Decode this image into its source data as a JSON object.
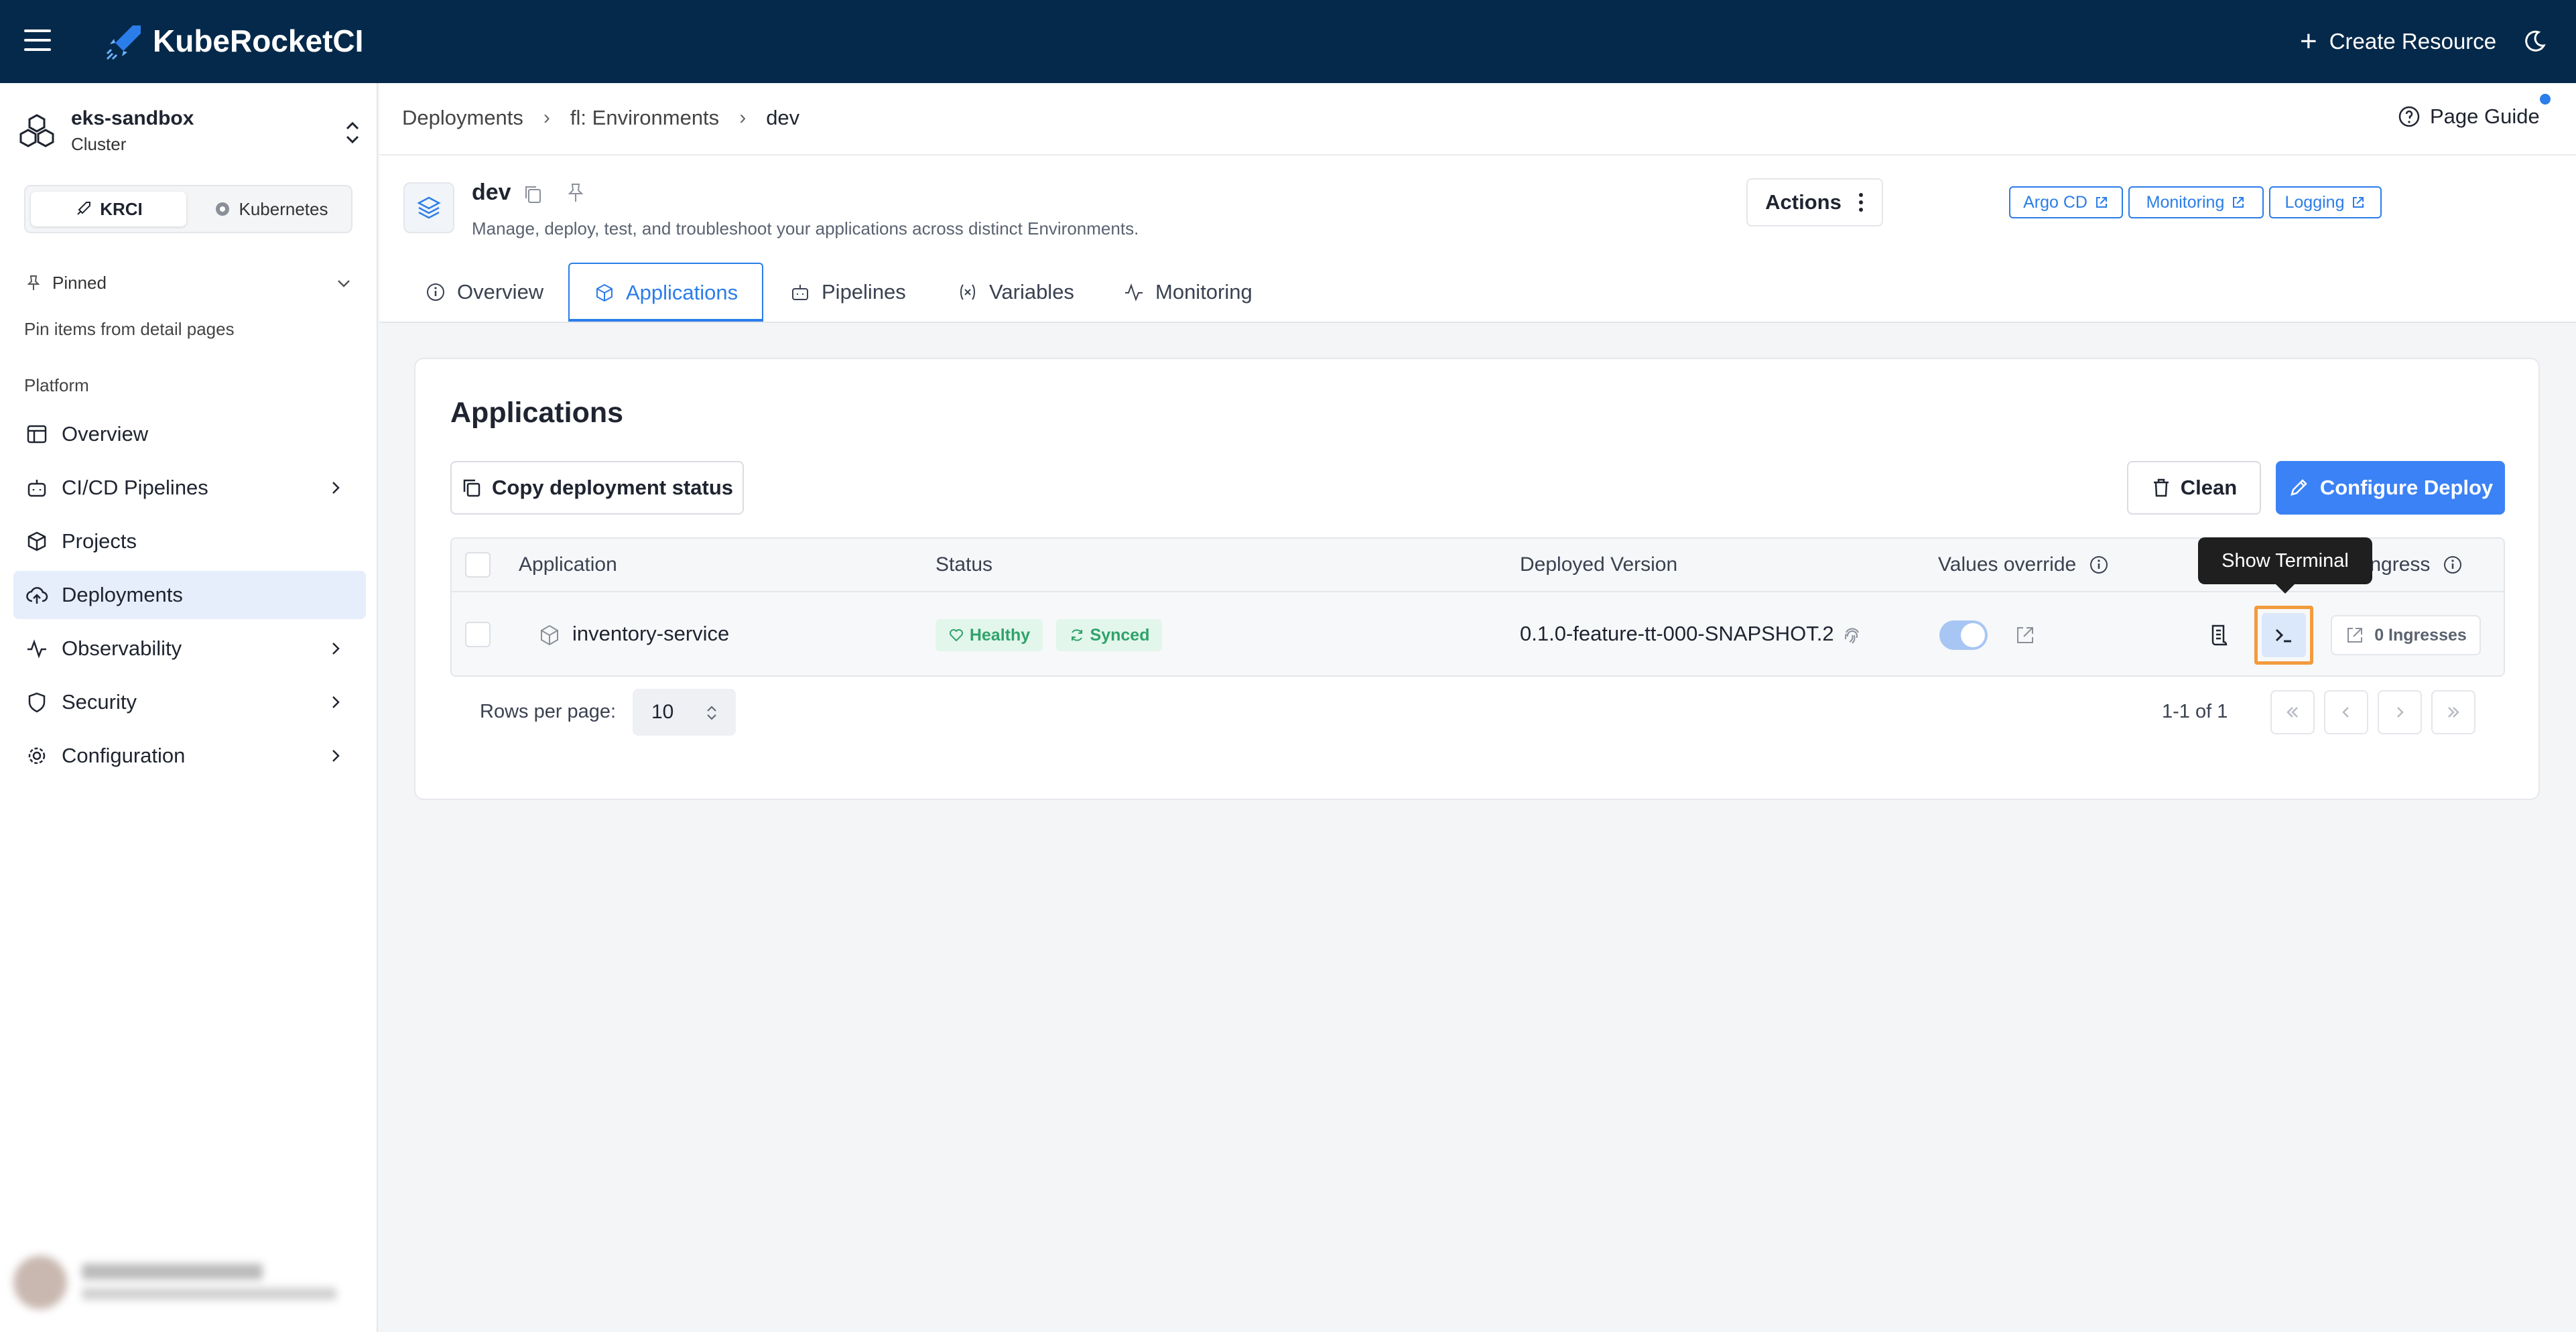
{
  "app": {
    "name": "KubeRocketCI"
  },
  "topbar": {
    "create_resource": "Create Resource"
  },
  "cluster": {
    "name": "eks-sandbox",
    "type": "Cluster"
  },
  "mode_switch": {
    "krci": "KRCI",
    "kubernetes": "Kubernetes"
  },
  "pinned": {
    "label": "Pinned",
    "hint": "Pin items from detail pages"
  },
  "nav": {
    "section": "Platform",
    "items": [
      {
        "label": "Overview"
      },
      {
        "label": "CI/CD Pipelines"
      },
      {
        "label": "Projects"
      },
      {
        "label": "Deployments"
      },
      {
        "label": "Observability"
      },
      {
        "label": "Security"
      },
      {
        "label": "Configuration"
      }
    ]
  },
  "breadcrumb": {
    "items": [
      "Deployments",
      "fl: Environments",
      "dev"
    ]
  },
  "page_guide": "Page Guide",
  "environment": {
    "name": "dev",
    "description": "Manage, deploy, test, and troubleshoot your applications across distinct Environments."
  },
  "links": {
    "argo": "Argo CD",
    "monitoring": "Monitoring",
    "logging": "Logging"
  },
  "actions": "Actions",
  "tabs": [
    "Overview",
    "Applications",
    "Pipelines",
    "Variables",
    "Monitoring"
  ],
  "card": {
    "title": "Applications",
    "copy_status": "Copy deployment status",
    "clean": "Clean",
    "configure": "Configure Deploy"
  },
  "table": {
    "columns": {
      "application": "Application",
      "status": "Status",
      "version": "Deployed Version",
      "values_override": "Values override",
      "ingress": "Ingress"
    },
    "rows": [
      {
        "application": "inventory-service",
        "health": "Healthy",
        "sync": "Synced",
        "version": "0.1.0-feature-tt-000-SNAPSHOT.2",
        "ingresses": "0 Ingresses"
      }
    ]
  },
  "tooltip": "Show Terminal",
  "pagination": {
    "rows_label": "Rows per page:",
    "rows_value": "10",
    "range": "1-1 of 1"
  },
  "colors": {
    "topbar": "#05294a",
    "primary": "#3b82f6",
    "healthy": "#2fa36b",
    "highlight": "#f39a3d"
  }
}
